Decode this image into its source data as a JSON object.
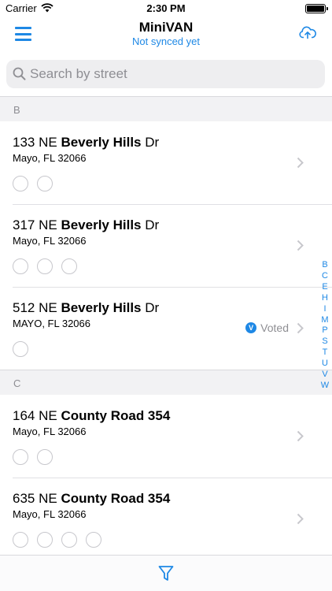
{
  "status_bar": {
    "carrier": "Carrier",
    "time": "2:30 PM"
  },
  "nav": {
    "title": "MiniVAN",
    "subtitle": "Not synced yet",
    "menu_icon": "hamburger-menu-icon",
    "upload_icon": "cloud-upload-icon"
  },
  "search": {
    "placeholder": "Search by street",
    "value": ""
  },
  "sections": [
    {
      "letter": "B",
      "rows": [
        {
          "number": "133 NE",
          "street": "Beverly Hills",
          "suffix": "Dr",
          "city": "Mayo, FL 32066",
          "circles": 2,
          "voted": ""
        },
        {
          "number": "317 NE",
          "street": "Beverly Hills",
          "suffix": "Dr",
          "city": "Mayo, FL 32066",
          "circles": 3,
          "voted": ""
        },
        {
          "number": "512 NE",
          "street": "Beverly Hills",
          "suffix": "Dr",
          "city": "MAYO, FL 32066",
          "circles": 1,
          "voted": "Voted",
          "voted_badge": "V"
        }
      ]
    },
    {
      "letter": "C",
      "rows": [
        {
          "number": "164 NE",
          "street": "County Road 354",
          "suffix": "",
          "city": "Mayo, FL 32066",
          "circles": 2,
          "voted": ""
        },
        {
          "number": "635 NE",
          "street": "County Road 354",
          "suffix": "",
          "city": "Mayo, FL 32066",
          "circles": 4,
          "voted": ""
        }
      ]
    }
  ],
  "index_letters": [
    "B",
    "C",
    "E",
    "H",
    "I",
    "M",
    "P",
    "S",
    "T",
    "U",
    "V",
    "W"
  ],
  "colors": {
    "accent": "#1e88e5",
    "secondary_text": "#8e8e93",
    "section_bg": "#f2f2f4"
  },
  "tab_bar": {
    "filter_icon": "filter-icon"
  }
}
